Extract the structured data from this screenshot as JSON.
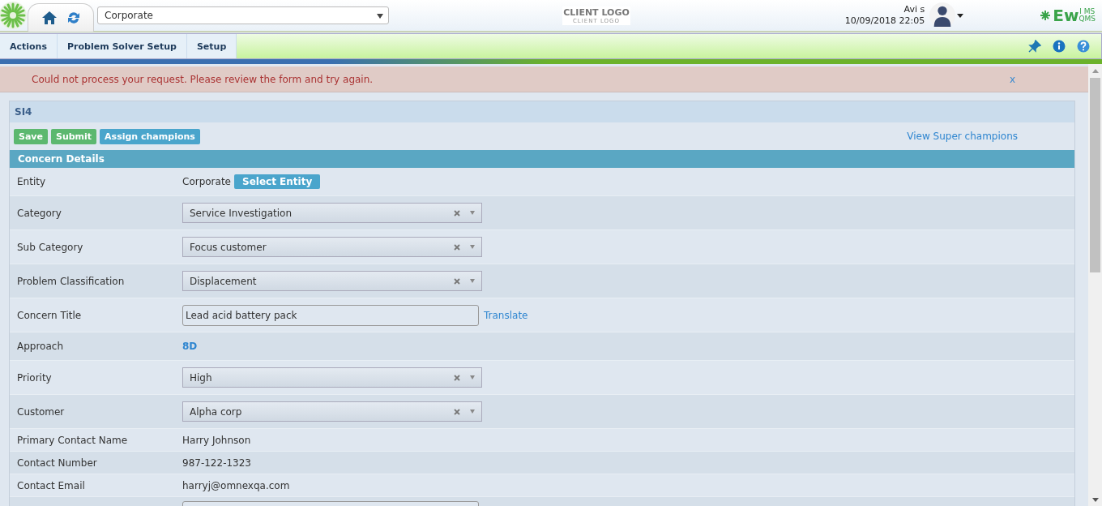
{
  "header": {
    "entity_select": "Corporate",
    "client_logo": {
      "title": "CLIENT LOGO",
      "subtitle": "CLIENT LOGO"
    },
    "user": {
      "name": "Avi s",
      "datetime": "10/09/2018 22:05"
    },
    "brand": {
      "main": "Ew",
      "top": "I MS",
      "bottom": "QMS"
    }
  },
  "menu": [
    {
      "label": "Actions"
    },
    {
      "label": "Problem Solver Setup"
    },
    {
      "label": "Setup"
    }
  ],
  "alert": {
    "message": "Could not process your request. Please review the form and try again.",
    "close": "x"
  },
  "form": {
    "title": "SI4",
    "buttons": [
      {
        "label": "Save",
        "kind": "success"
      },
      {
        "label": "Submit",
        "kind": "success"
      },
      {
        "label": "Assign champions",
        "kind": "info"
      }
    ],
    "link": "View Super champions",
    "section": "Concern Details",
    "rows": [
      {
        "kind": "entity",
        "label": "Entity",
        "value": "Corporate",
        "action": "Select Entity"
      },
      {
        "kind": "select",
        "label": "Category",
        "value": "Service Investigation"
      },
      {
        "kind": "select",
        "label": "Sub Category",
        "value": "Focus customer"
      },
      {
        "kind": "select",
        "label": "Problem Classification",
        "value": "Displacement"
      },
      {
        "kind": "input",
        "label": "Concern Title",
        "value": "Lead acid battery pack",
        "link": "Translate"
      },
      {
        "kind": "link",
        "label": "Approach",
        "value": "8D"
      },
      {
        "kind": "select",
        "label": "Priority",
        "value": "High"
      },
      {
        "kind": "select",
        "label": "Customer",
        "value": "Alpha corp"
      },
      {
        "kind": "text",
        "label": "Primary Contact Name",
        "value": "Harry Johnson"
      },
      {
        "kind": "text",
        "label": "Contact Number",
        "value": "987-122-1323"
      },
      {
        "kind": "text",
        "label": "Contact Email",
        "value": "harryj@omnexqa.com"
      },
      {
        "kind": "input"
      }
    ]
  }
}
